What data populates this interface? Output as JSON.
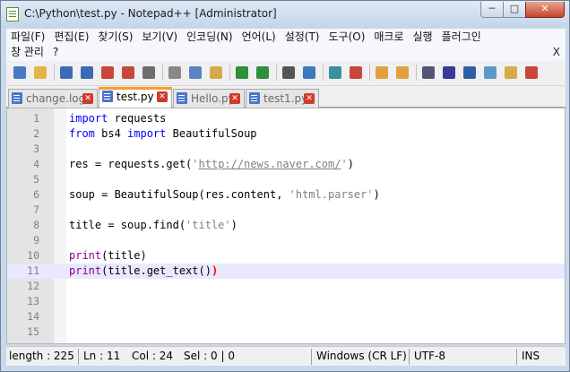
{
  "window": {
    "title": "C:\\Python\\test.py - Notepad++ [Administrator]",
    "minimize_label": "─",
    "maximize_label": "□",
    "close_label": "✕"
  },
  "menu": {
    "row1": [
      "파일(F)",
      "편집(E)",
      "찾기(S)",
      "보기(V)",
      "인코딩(N)",
      "언어(L)",
      "설정(T)",
      "도구(O)",
      "매크로",
      "실행",
      "플러그인"
    ],
    "row2": [
      "창 관리",
      "?"
    ],
    "close_label": "X"
  },
  "toolbar": {
    "icons": [
      "new-file-icon",
      "open-file-icon",
      "save-icon",
      "save-all-icon",
      "close-icon",
      "close-all-icon",
      "print-icon",
      "cut-icon",
      "copy-icon",
      "paste-icon",
      "undo-icon",
      "redo-icon",
      "find-icon",
      "replace-icon",
      "zoom-in-icon",
      "zoom-out-icon",
      "sync-vertical-icon",
      "sync-horizontal-icon",
      "word-wrap-icon",
      "show-all-chars-icon",
      "indent-guide-icon",
      "doc-map-icon",
      "function-list-icon",
      "record-macro-icon"
    ]
  },
  "tabs": [
    {
      "label": "change.log",
      "active": false
    },
    {
      "label": "test.py",
      "active": true
    },
    {
      "label": "Hello.py",
      "active": false
    },
    {
      "label": "test1.py",
      "active": false
    }
  ],
  "tab_close_glyph": "✕",
  "editor": {
    "lines": [
      {
        "num": "1",
        "html": "<span class=\"kw\">import</span> requests"
      },
      {
        "num": "2",
        "html": "<span class=\"kw\">from</span> bs4 <span class=\"kw\">import</span> BeautifulSoup"
      },
      {
        "num": "3",
        "html": ""
      },
      {
        "num": "4",
        "html": "res = requests.get(<span class=\"str\">'</span><span class=\"url\">http://news.naver.com/</span><span class=\"str\">'</span>)"
      },
      {
        "num": "5",
        "html": ""
      },
      {
        "num": "6",
        "html": "soup = BeautifulSoup(res.content, <span class=\"str\">'html.parser'</span>)"
      },
      {
        "num": "7",
        "html": ""
      },
      {
        "num": "8",
        "html": "title = soup.find(<span class=\"str\">'title'</span>)"
      },
      {
        "num": "9",
        "html": ""
      },
      {
        "num": "10",
        "html": "<span class=\"kw2\">print</span>(title)"
      },
      {
        "num": "11",
        "html": "<span class=\"kw2\">print</span>(title.get_text()<span class=\"paren-hl\">)</span>",
        "current": true
      },
      {
        "num": "12",
        "html": ""
      },
      {
        "num": "13",
        "html": ""
      },
      {
        "num": "14",
        "html": ""
      },
      {
        "num": "15",
        "html": ""
      }
    ]
  },
  "status": {
    "length": "length : 225",
    "ln": "Ln : 11",
    "col": "Col : 24",
    "sel": "Sel : 0 | 0",
    "eol": "Windows (CR LF)",
    "encoding": "UTF-8",
    "mode": "INS"
  },
  "colors": {
    "keyword": "#0000ff",
    "builtin": "#880088",
    "string": "#808080",
    "active_tab_accent": "#fa9b2c",
    "current_line": "#e8e8ff"
  }
}
